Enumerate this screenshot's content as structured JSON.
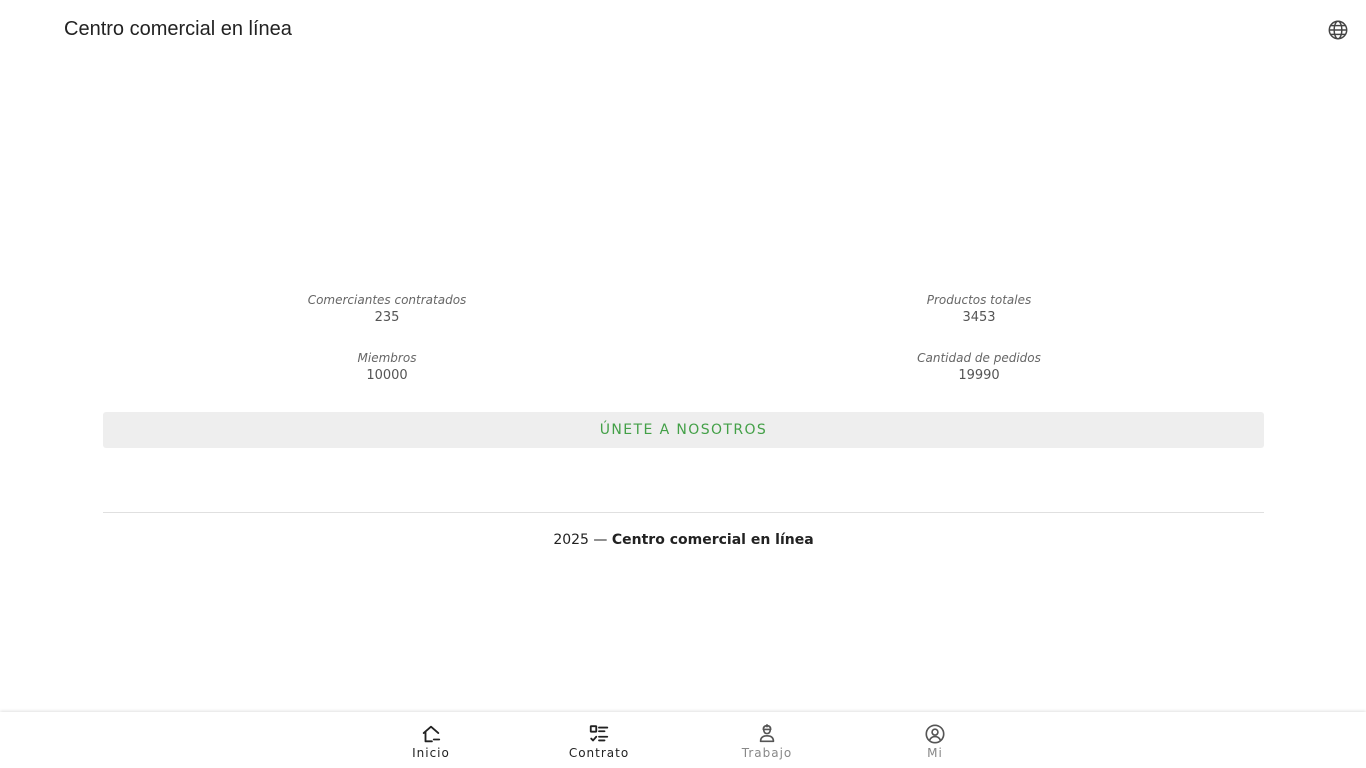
{
  "header": {
    "title": "Centro comercial en línea",
    "language_icon": "globe-icon"
  },
  "stats": [
    {
      "label": "Comerciantes contratados",
      "value": "235"
    },
    {
      "label": "Productos totales",
      "value": "3453"
    },
    {
      "label": "Miembros",
      "value": "10000"
    },
    {
      "label": "Cantidad de pedidos",
      "value": "19990"
    }
  ],
  "join_button": {
    "label": "ÚNETE A NOSOTROS",
    "color": "#43a047"
  },
  "footer": {
    "year": "2025",
    "separator": "—",
    "brand": "Centro comercial en línea"
  },
  "bottom_nav": {
    "items": [
      {
        "label": "Inicio",
        "icon": "home-icon",
        "active": true
      },
      {
        "label": "Contrato",
        "icon": "checklist-icon",
        "active": true
      },
      {
        "label": "Trabajo",
        "icon": "worker-icon",
        "active": false
      },
      {
        "label": "Mi",
        "icon": "user-circle-icon",
        "active": false
      }
    ]
  },
  "colors": {
    "text": "#222222",
    "muted": "#888888",
    "accent_green": "#43a047",
    "button_bg": "#eeeeee"
  }
}
